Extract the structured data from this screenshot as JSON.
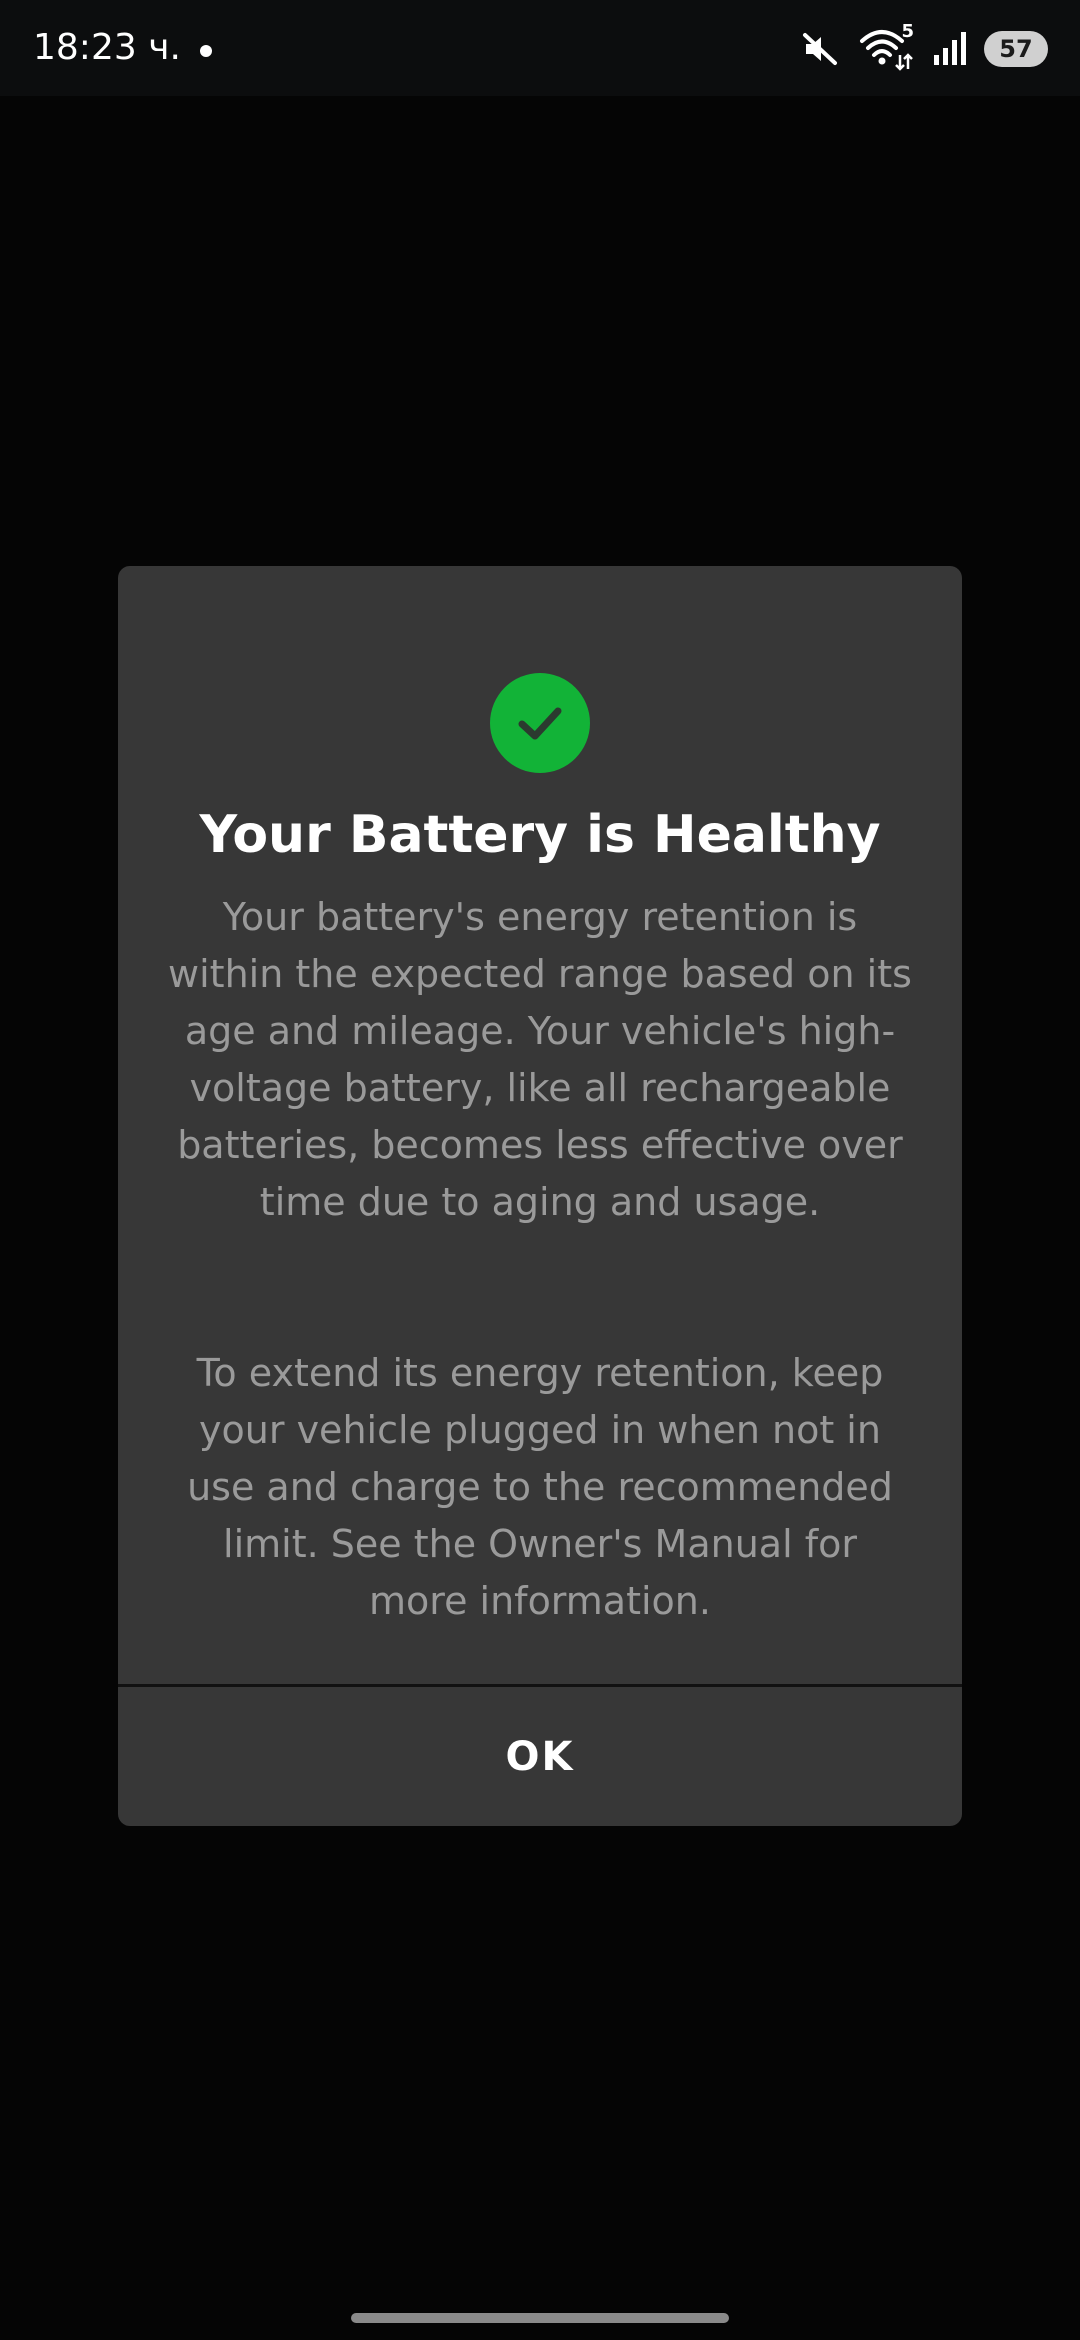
{
  "status_bar": {
    "time": "18:23 ч.",
    "wifi_badge": "5",
    "battery_level": "57",
    "icons": [
      "mute-icon",
      "wifi-icon",
      "signal-icon",
      "battery-icon"
    ]
  },
  "dialog": {
    "icon": "checkmark-icon",
    "title": "Your Battery is Healthy",
    "paragraph_1": "Your battery's energy retention is within the expected range based on its age and mileage. Your vehicle's high-voltage battery, like all rechargeable batteries, becomes less effective over time due to aging and usage.",
    "paragraph_2": "To extend its energy retention, keep your vehicle plugged in when not in use and charge to the recommended limit. See the Owner's Manual for more information.",
    "ok_label": "OK"
  },
  "colors": {
    "background": "#050505",
    "dialog": "#373737",
    "accent_green": "#12b337",
    "title_text": "#ffffff",
    "body_text": "#9a9a9a"
  }
}
